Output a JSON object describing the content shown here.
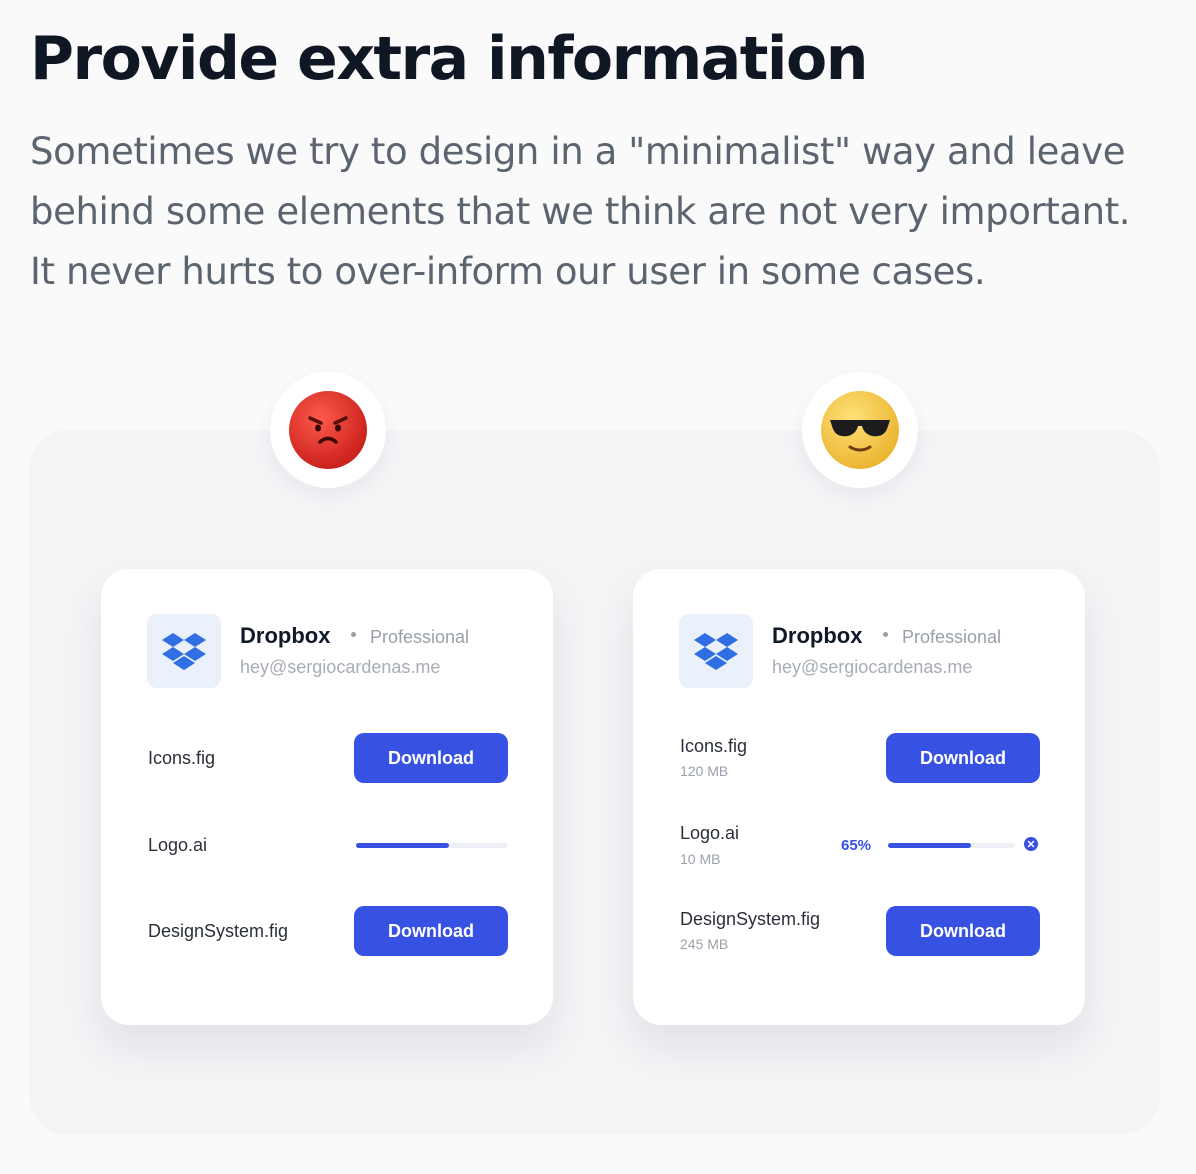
{
  "headline": "Provide extra information",
  "intro_lines": [
    "Sometimes we try to design in a \"minimalist\" way and leave",
    "behind some elements that we think are not very important.",
    "It never hurts to over-inform our user in some cases."
  ],
  "emojis": {
    "bad": "angry-face",
    "good": "smiling-face-with-sunglasses"
  },
  "colors": {
    "accent": "#3751e3",
    "angry": "#e0302a",
    "happy": "#f5c842"
  },
  "card_bad": {
    "app_name": "Dropbox",
    "plan": "Professional",
    "email": "hey@sergiocardenas.me",
    "files": [
      {
        "name": "Icons.fig",
        "action": "Download"
      },
      {
        "name": "Logo.ai",
        "progress": 0.61
      },
      {
        "name": "DesignSystem.fig",
        "action": "Download"
      }
    ]
  },
  "card_good": {
    "app_name": "Dropbox",
    "plan": "Professional",
    "email": "hey@sergiocardenas.me",
    "files": [
      {
        "name": "Icons.fig",
        "size": "120 MB",
        "action": "Download"
      },
      {
        "name": "Logo.ai",
        "size": "10 MB",
        "progress_label": "65%",
        "progress": 0.65
      },
      {
        "name": "DesignSystem.fig",
        "size": "245 MB",
        "action": "Download"
      }
    ]
  }
}
